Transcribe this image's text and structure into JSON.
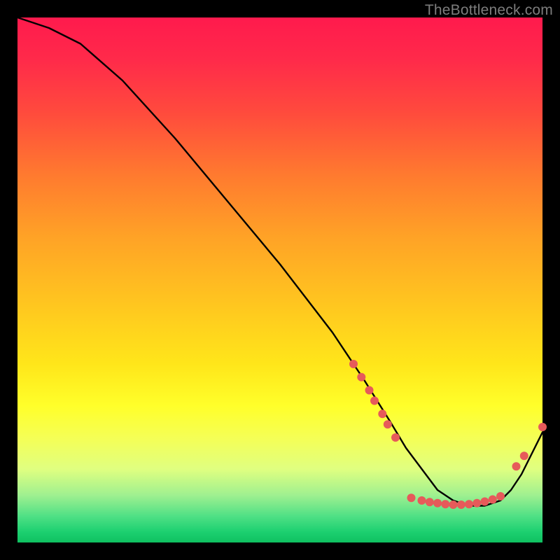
{
  "watermark": "TheBottleneck.com",
  "chart_data": {
    "type": "line",
    "title": "",
    "xlabel": "",
    "ylabel": "",
    "xlim": [
      0,
      100
    ],
    "ylim": [
      0,
      100
    ],
    "series": [
      {
        "name": "bottleneck-curve",
        "x": [
          0,
          6,
          12,
          20,
          30,
          40,
          50,
          60,
          66,
          71,
          74,
          77,
          80,
          83,
          86,
          89,
          92,
          94,
          96,
          98,
          100
        ],
        "y": [
          100,
          98,
          95,
          88,
          77,
          65,
          53,
          40,
          31,
          23,
          18,
          14,
          10,
          8,
          7,
          7,
          8,
          10,
          13,
          17,
          21
        ]
      }
    ],
    "markers": {
      "name": "highlighted-points",
      "points": [
        {
          "x": 64.0,
          "y": 34.0
        },
        {
          "x": 65.5,
          "y": 31.5
        },
        {
          "x": 67.0,
          "y": 29.0
        },
        {
          "x": 68.0,
          "y": 27.0
        },
        {
          "x": 69.5,
          "y": 24.5
        },
        {
          "x": 70.5,
          "y": 22.5
        },
        {
          "x": 72.0,
          "y": 20.0
        },
        {
          "x": 75.0,
          "y": 8.5
        },
        {
          "x": 77.0,
          "y": 8.0
        },
        {
          "x": 78.5,
          "y": 7.7
        },
        {
          "x": 80.0,
          "y": 7.5
        },
        {
          "x": 81.5,
          "y": 7.3
        },
        {
          "x": 83.0,
          "y": 7.2
        },
        {
          "x": 84.5,
          "y": 7.2
        },
        {
          "x": 86.0,
          "y": 7.3
        },
        {
          "x": 87.5,
          "y": 7.5
        },
        {
          "x": 89.0,
          "y": 7.8
        },
        {
          "x": 90.5,
          "y": 8.2
        },
        {
          "x": 92.0,
          "y": 8.8
        },
        {
          "x": 95.0,
          "y": 14.5
        },
        {
          "x": 96.5,
          "y": 16.5
        },
        {
          "x": 100.0,
          "y": 22.0
        }
      ]
    },
    "marker_color": "#e65a5a",
    "line_color": "#000000"
  }
}
